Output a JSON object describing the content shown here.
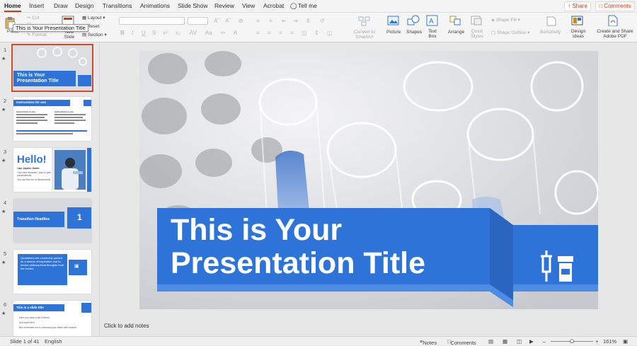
{
  "ribbon_tabs": [
    "Home",
    "Insert",
    "Draw",
    "Design",
    "Transitions",
    "Animations",
    "Slide Show",
    "Review",
    "View",
    "Acrobat"
  ],
  "tell_me": "Tell me",
  "share_label": "Share",
  "comments_label": "Comments",
  "toolbar": {
    "paste": "Paste",
    "cut": "Cut",
    "format": "Format",
    "new_slide": "New Slide",
    "layout": "Layout",
    "reset": "Reset",
    "section": "Section",
    "convert_smartart": "Convert to SmartArt",
    "picture": "Picture",
    "shapes": "Shapes",
    "text_box": "Text Box",
    "arrange": "Arrange",
    "quick_styles": "Quick Styles",
    "shape_fill": "Shape Fill",
    "shape_outline": "Shape Outline",
    "sensitivity": "Sensitivity",
    "design_ideas": "Design Ideas",
    "create_share_pdf": "Create and Share Adobe PDF"
  },
  "tooltip": "This is Your Presentation Title",
  "thumbnails": [
    {
      "num": "1",
      "title": "This is Your Presentation Title"
    },
    {
      "num": "2",
      "title": "Instructions for use",
      "sub_left": "Instructions to use",
      "sub_right": "Instructions to use"
    },
    {
      "num": "3",
      "title": "Hello!",
      "body": "I am Jayden Smith",
      "body2": "I am here because I love to give presentations.",
      "body3": "You can find me at @username"
    },
    {
      "num": "4",
      "title": "Transition Headline",
      "number": "1"
    },
    {
      "num": "5",
      "title": "Quotations are commonly printed as a means of inspiration and to invoke philosophical thoughts from the reader."
    },
    {
      "num": "6",
      "title": "This is a slide title",
      "bullets": [
        "Here you have a list of items",
        "And some text",
        "But remember not to overload your slides with content"
      ]
    }
  ],
  "slide": {
    "title_line1": "This is Your",
    "title_line2": "Presentation Title"
  },
  "notes_placeholder": "Click to add notes",
  "status": {
    "slide_counter": "Slide 1 of 41",
    "language": "English",
    "notes": "Notes",
    "comments": "Comments",
    "zoom": "161%"
  },
  "colors": {
    "accent_blue": "#2e74d8",
    "office_red": "#c43e1c"
  }
}
